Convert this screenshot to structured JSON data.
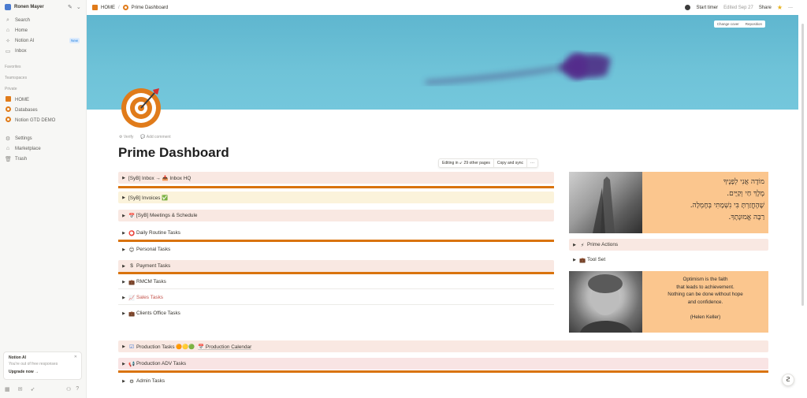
{
  "sidebar": {
    "workspace": "Ronen Mayer",
    "items": [
      {
        "label": "Search",
        "icon": "search-icon"
      },
      {
        "label": "Home",
        "icon": "home-icon"
      },
      {
        "label": "Notion AI",
        "icon": "notion-ai-icon",
        "badge": "New"
      },
      {
        "label": "Inbox",
        "icon": "inbox-icon"
      }
    ],
    "sections": {
      "favorites": "Favorites",
      "teamspaces": "Teamspaces",
      "private": "Private"
    },
    "private_items": [
      {
        "label": "HOME",
        "icon": "home-page-icon"
      },
      {
        "label": "Databases",
        "icon": "ring-icon"
      },
      {
        "label": "Notion GTD DEMO",
        "icon": "ring-icon"
      }
    ],
    "bottom_items": [
      {
        "label": "Settings",
        "icon": "gear-icon"
      },
      {
        "label": "Marketplace",
        "icon": "store-icon"
      },
      {
        "label": "Trash",
        "icon": "trash-icon"
      }
    ],
    "ai_card": {
      "title": "Notion AI",
      "subtitle": "You're out of free responses",
      "cta": "Upgrade now →"
    }
  },
  "topbar": {
    "breadcrumb": [
      "HOME",
      "Prime Dashboard"
    ],
    "start_timer": "Start timer",
    "edited": "Edited Sep 27",
    "share": "Share"
  },
  "cover": {
    "change_cover": "Change cover",
    "reposition": "Reposition",
    "color": "#6fc3d8"
  },
  "page": {
    "meta": [
      "Verify",
      "Add comment"
    ],
    "title": "Prime Dashboard",
    "sync": {
      "editing": "Editing in ↙ 29 other pages",
      "copy": "Copy and sync",
      "more": "···"
    }
  },
  "left_rows": [
    {
      "icon": "",
      "label": "[SyB] Inbox → 📥 Inbox HQ"
    },
    {
      "icon": "",
      "label": "[SyB] Invoices ✅"
    },
    {
      "icon": "📅",
      "label": "[SyB] Meetings & Schedule"
    },
    {
      "icon": "⭕",
      "label": "Daily Routine Tasks"
    },
    {
      "icon": "😊",
      "label": "Personal Tasks"
    },
    {
      "icon": "$",
      "label": "Payment Tasks"
    },
    {
      "icon": "💼",
      "label": "RMCM Tasks"
    },
    {
      "icon": "📈",
      "label": "Sales Tasks"
    },
    {
      "icon": "💼",
      "label": "Clients Office Tasks"
    }
  ],
  "right_rows": [
    {
      "icon": "⚡",
      "label": "Prime Actions"
    },
    {
      "icon": "💼",
      "label": "Tool Set"
    }
  ],
  "hebrew_quote": [
    "מוֹדֶה אֲנִי לְפָנֶיךָ",
    "מֶלֶךְ חַי וְקַיָּים.",
    "שֶׁהֶחֱזַרְתָּ בִּי נִשְׁמָתִי בְּחֶמְלָה.",
    "רַבָּה אֱמוּנָתֶךָ."
  ],
  "english_quote": [
    "Optimism is the faith",
    "that leads to achievement.",
    "Nothing can be done without hope",
    "and confidence.",
    "",
    "(Helen Keller)"
  ],
  "bottom_rows": [
    {
      "icon": "☑",
      "label": "Production Tasks 🟠🟡🟢",
      "link": "📅 Production Calendar"
    },
    {
      "icon": "📢",
      "label": "Production ADV Tasks"
    },
    {
      "icon": "⚙",
      "label": "Admin Tasks"
    }
  ],
  "colors": {
    "accent": "#d9730d",
    "row_pink": "#f9e8e2",
    "row_cream": "#fbf3db",
    "quote_bg": "#fbc68e"
  }
}
